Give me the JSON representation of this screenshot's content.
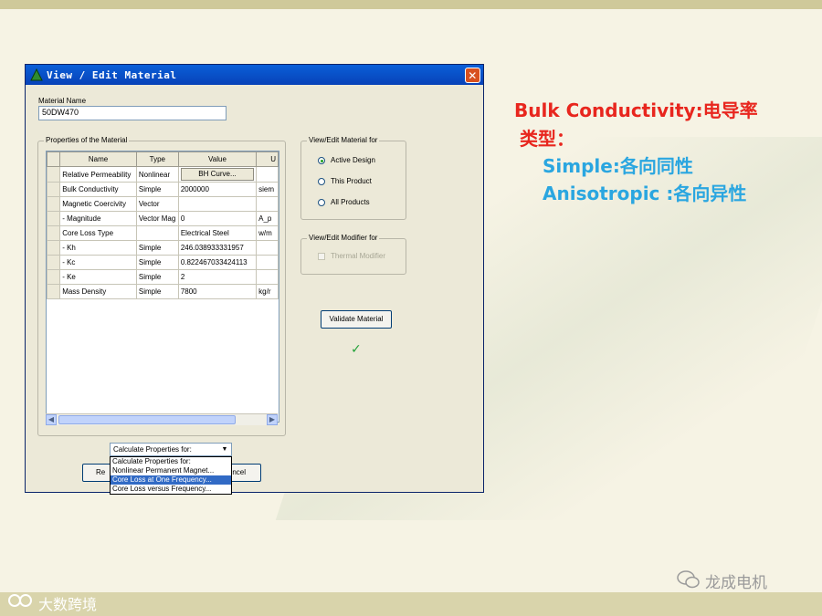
{
  "dialog": {
    "title": "View / Edit Material",
    "close_symbol": "✕",
    "material_name_label": "Material Name",
    "material_name_value": "50DW470",
    "properties_group_label": "Properties of the Material",
    "columns": [
      "Name",
      "Type",
      "Value",
      "U"
    ],
    "rows": [
      {
        "name": "Relative Permeability",
        "type": "Nonlinear",
        "value": "BH Curve...",
        "unit": "",
        "is_button": true
      },
      {
        "name": "Bulk Conductivity",
        "type": "Simple",
        "value": "2000000",
        "unit": "siem"
      },
      {
        "name": "Magnetic Coercivity",
        "type": "Vector",
        "value": "",
        "unit": ""
      },
      {
        "name": "- Magnitude",
        "type": "Vector Mag",
        "value": "0",
        "unit": "A_p"
      },
      {
        "name": "Core Loss Type",
        "type": "",
        "value": "Electrical Steel",
        "unit": "w/m"
      },
      {
        "name": "- Kh",
        "type": "Simple",
        "value": "246.038933331957",
        "unit": ""
      },
      {
        "name": "- Kc",
        "type": "Simple",
        "value": "0.822467033424113",
        "unit": ""
      },
      {
        "name": "- Ke",
        "type": "Simple",
        "value": "2",
        "unit": ""
      },
      {
        "name": "Mass Density",
        "type": "Simple",
        "value": "7800",
        "unit": "kg/r"
      }
    ],
    "view_edit_for_label": "View/Edit Material for",
    "view_edit_options": [
      "Active Design",
      "This Product",
      "All Products"
    ],
    "view_edit_selected": "Active Design",
    "modifier_label": "View/Edit Modifier for",
    "thermal_modifier_label": "Thermal Modifier",
    "validate_button": "Validate Material",
    "validate_check": "✓",
    "calc_combo_value": "Calculate Properties for:",
    "calc_options": [
      "Calculate Properties for:",
      "Nonlinear Permanent Magnet...",
      "Core Loss at One Frequency...",
      "Core Loss versus Frequency..."
    ],
    "calc_selected": "Core Loss at One Frequency...",
    "reset_button_partial": "Re",
    "cancel_button_partial": "ncel"
  },
  "slide": {
    "line1": "Bulk Conductivity:电导率",
    "line2": "类型：",
    "line3": "Simple:各向同性",
    "line4": "Anisotropic :各向异性"
  },
  "colors": {
    "red": "#e8261e",
    "blue": "#2aa6e0"
  },
  "watermarks": {
    "right": "龙成电机",
    "left": "大数跨境"
  }
}
